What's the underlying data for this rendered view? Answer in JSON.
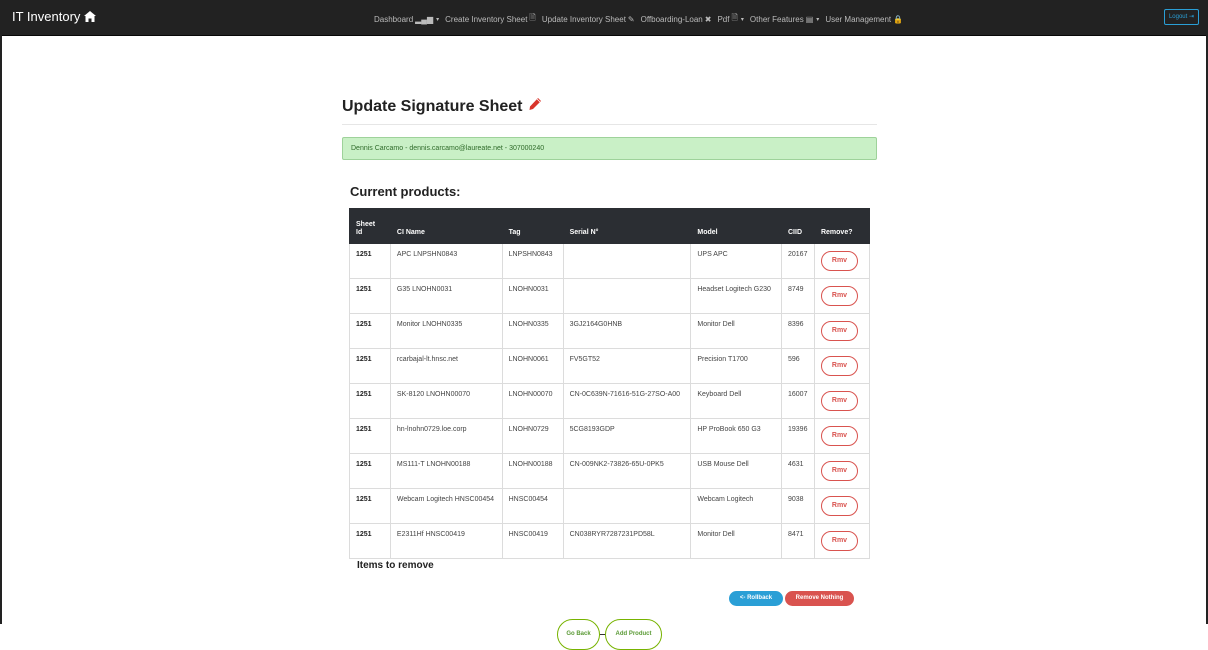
{
  "navbar": {
    "brand": "IT Inventory",
    "items": [
      {
        "label": "Dashboard",
        "glyph": "▂▄▆",
        "caret": "▾"
      },
      {
        "label": "Create Inventory Sheet",
        "glyph": "🗎",
        "caret": ""
      },
      {
        "label": "Update Inventory Sheet",
        "glyph": "✎",
        "caret": ""
      },
      {
        "label": "Offboarding-Loan",
        "glyph": "✖",
        "caret": ""
      },
      {
        "label": "Pdf",
        "glyph": "🗎",
        "caret": "▾"
      },
      {
        "label": "Other Features",
        "glyph": "▤",
        "caret": "▾"
      },
      {
        "label": "User Management",
        "glyph": "🔒",
        "caret": ""
      }
    ],
    "logout": "Logout ⇥"
  },
  "page": {
    "title": "Update Signature Sheet",
    "alert": "Dennis Carcamo - dennis.carcamo@laureate.net - 307000240",
    "section_title": "Current products:",
    "items_to_remove": "Items to remove"
  },
  "table": {
    "headers": {
      "sheet_id_1": "Sheet",
      "sheet_id_2": "Id",
      "ci_name": "CI Name",
      "tag": "Tag",
      "serial": "Serial N°",
      "model": "Model",
      "ciid": "CIID",
      "remove": "Remove?"
    },
    "rows": [
      {
        "sheet_id": "1251",
        "ci_name": "APC LNPSHN0843",
        "tag": "LNPSHN0843",
        "serial": "",
        "model": "UPS APC",
        "ciid": "20167",
        "rmv": "Rmv"
      },
      {
        "sheet_id": "1251",
        "ci_name": "G35 LNOHN0031",
        "tag": "LNOHN0031",
        "serial": "",
        "model": "Headset Logitech G230",
        "ciid": "8749",
        "rmv": "Rmv"
      },
      {
        "sheet_id": "1251",
        "ci_name": "Monitor LNOHN0335",
        "tag": "LNOHN0335",
        "serial": "3GJ2164G0HNB",
        "model": "Monitor Dell",
        "ciid": "8396",
        "rmv": "Rmv"
      },
      {
        "sheet_id": "1251",
        "ci_name": "rcarbajal-lt.hnsc.net",
        "tag": "LNOHN0061",
        "serial": "FV5GT52",
        "model": "Precision T1700",
        "ciid": "596",
        "rmv": "Rmv"
      },
      {
        "sheet_id": "1251",
        "ci_name": "SK-8120 LNOHN00070",
        "tag": "LNOHN00070",
        "serial": "CN-0C639N-71616-51G-27SO-A00",
        "model": "Keyboard Dell",
        "ciid": "16007",
        "rmv": "Rmv"
      },
      {
        "sheet_id": "1251",
        "ci_name": "hn-lnohn0729.loe.corp",
        "tag": "LNOHN0729",
        "serial": "5CG8193GDP",
        "model": "HP ProBook 650 G3",
        "ciid": "19396",
        "rmv": "Rmv"
      },
      {
        "sheet_id": "1251",
        "ci_name": "MS111-T LNOHN00188",
        "tag": "LNOHN00188",
        "serial": "CN-009NK2-73826-65U-0PK5",
        "model": "USB Mouse Dell",
        "ciid": "4631",
        "rmv": "Rmv"
      },
      {
        "sheet_id": "1251",
        "ci_name": "Webcam Logitech HNSC00454",
        "tag": "HNSC00454",
        "serial": "",
        "model": "Webcam Logitech",
        "ciid": "9038",
        "rmv": "Rmv"
      },
      {
        "sheet_id": "1251",
        "ci_name": "E2311Hf HNSC00419",
        "tag": "HNSC00419",
        "serial": "CN038RYR7287231PD58L",
        "model": "Monitor Dell",
        "ciid": "8471",
        "rmv": "Rmv"
      }
    ]
  },
  "buttons": {
    "rollback": "<- Rollback",
    "remove_nothing": "Remove Nothing",
    "go_back": "Go Back",
    "add_product": "Add Product"
  },
  "colors": {
    "navbar_bg": "#222222",
    "primary": "#2a9fd6",
    "danger": "#d9534f",
    "success": "#77b300",
    "alert_bg": "#c9f0c6"
  }
}
